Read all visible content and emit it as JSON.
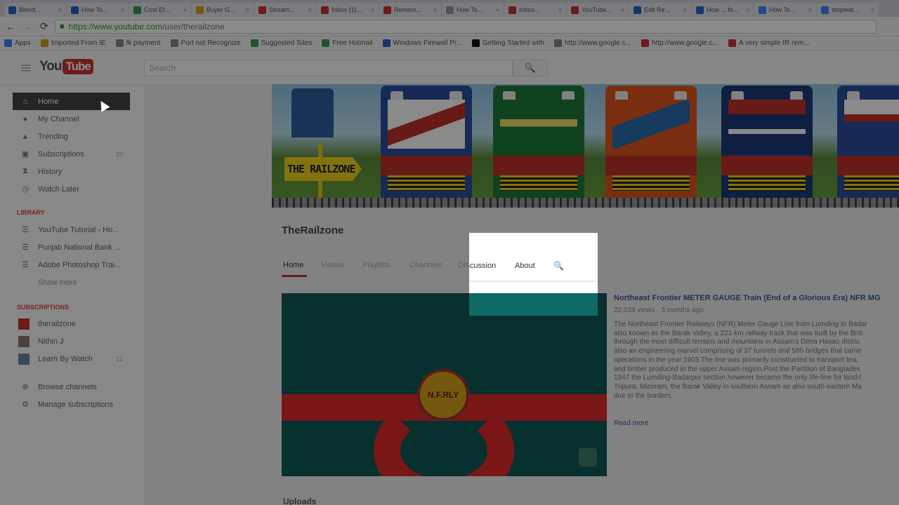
{
  "browser": {
    "tabs": [
      {
        "label": "Blend...",
        "color": "#2b63c6"
      },
      {
        "label": "How To...",
        "color": "#2b63c6"
      },
      {
        "label": "Cost Ef...",
        "color": "#3c9a52"
      },
      {
        "label": "Buyer G...",
        "color": "#d9a21c"
      },
      {
        "label": "Stream...",
        "color": "#cc3333"
      },
      {
        "label": "Inbox (1)...",
        "color": "#cc3333"
      },
      {
        "label": "Remem...",
        "color": "#cc3333"
      },
      {
        "label": "How To...",
        "color": "#999999"
      },
      {
        "label": "Inbox...",
        "color": "#cc3333"
      },
      {
        "label": "YouTube...",
        "color": "#cc3333"
      },
      {
        "label": "Edit Re...",
        "color": "#2b63c6"
      },
      {
        "label": "How ... fo...",
        "color": "#2b63c6"
      },
      {
        "label": "How To...",
        "color": "#4285f4"
      },
      {
        "label": "stopwat...",
        "color": "#4285f4"
      }
    ],
    "tab_close": "×",
    "back_icon": "←",
    "forward_icon": "→",
    "reload_icon": "⟳",
    "url_scheme": "https://www.youtube.com",
    "url_path": "/user/therailzone",
    "bookmarks": [
      {
        "label": "Apps",
        "color": "#4285f4"
      },
      {
        "label": "Imported From IE",
        "color": "#d9a21c"
      },
      {
        "label": "fk payment",
        "color": "#888888"
      },
      {
        "label": "Port not Recognize",
        "color": "#888888"
      },
      {
        "label": "Suggested Sites",
        "color": "#3c9a52"
      },
      {
        "label": "Free Hotmail",
        "color": "#3c9a52"
      },
      {
        "label": "Windows Firewall Pr...",
        "color": "#2b63c6"
      },
      {
        "label": "Getting Started with",
        "color": "#111111"
      },
      {
        "label": "http://www.google.c...",
        "color": "#888888"
      },
      {
        "label": "http://www.google.c...",
        "color": "#cc3333"
      },
      {
        "label": "A very simple IR rem...",
        "color": "#cc3333"
      }
    ]
  },
  "youtube": {
    "logo_you": "You",
    "logo_tube": "Tube",
    "search_placeholder": "Search",
    "search_icon": "🔍"
  },
  "sidebar": {
    "nav": [
      {
        "label": "Home",
        "icon": "⌂",
        "active": true,
        "count": ""
      },
      {
        "label": "My Channel",
        "icon": "●",
        "active": false,
        "count": ""
      },
      {
        "label": "Trending",
        "icon": "▲",
        "active": false,
        "count": ""
      },
      {
        "label": "Subscriptions",
        "icon": "▣",
        "active": false,
        "count": "20"
      },
      {
        "label": "History",
        "icon": "⧗",
        "active": false,
        "count": ""
      },
      {
        "label": "Watch Later",
        "icon": "◷",
        "active": false,
        "count": ""
      }
    ],
    "library_heading": "LIBRARY",
    "library": [
      {
        "label": "YouTube Tutorial - Ho..."
      },
      {
        "label": "Punjab National Bank ..."
      },
      {
        "label": "Adobe Photoshop Trai..."
      }
    ],
    "show_more": "Show more",
    "subscriptions_heading": "SUBSCRIPTIONS",
    "subscriptions": [
      {
        "label": "therailzone",
        "color": "#cc3333",
        "count": ""
      },
      {
        "label": "Nithin J",
        "color": "#8a7a6a",
        "count": ""
      },
      {
        "label": "Learn By Watch",
        "color": "#6a8a9a",
        "count": "21"
      }
    ],
    "footer": [
      {
        "label": "Browse channels",
        "icon": "⊕"
      },
      {
        "label": "Manage subscriptions",
        "icon": "⚙"
      }
    ]
  },
  "channel": {
    "banner_sign": "THE RAILZONE",
    "name": "TheRailzone",
    "tabs": [
      "Home",
      "Videos",
      "Playlists",
      "Channels",
      "Discussion",
      "About"
    ],
    "active_tab": "Home",
    "spotlight_tabs": [
      "Discussion",
      "About"
    ],
    "featured": {
      "title": "Northeast Frontier METER GAUGE Train (End of a Glorious Era) NFR MG",
      "meta": "22,039 views · 3 months ago",
      "description": [
        "The Northeast Frontier Railways (NFR) Meter Gauge Line from Lumding to Badar",
        "also known as the Barak Valley, a 221-km railway track that was built by the Briti",
        "through the most difficult terrains and mountains in Assam's Dima Hasao distric",
        "also an engineering marvel comprising of 37 tunnels and 586 bridges that came",
        "operations in the year 1903 The line was primarily constructed to transport tea,",
        "and timber produced in the upper Assam region.Post the Partition of Banglades",
        "1947 the Lumding-Badarpur section however became the only life-line for land-l",
        "Tripura, Mizoram, the Barak Valley in southern Assam as also south-eastern Ma",
        "due to the borders."
      ],
      "read_more": "Read more",
      "logo_text": "N.F.RLY"
    },
    "uploads_heading": "Uploads"
  },
  "colors": {
    "accent": "#cc3333",
    "link": "#3a5a9a"
  }
}
